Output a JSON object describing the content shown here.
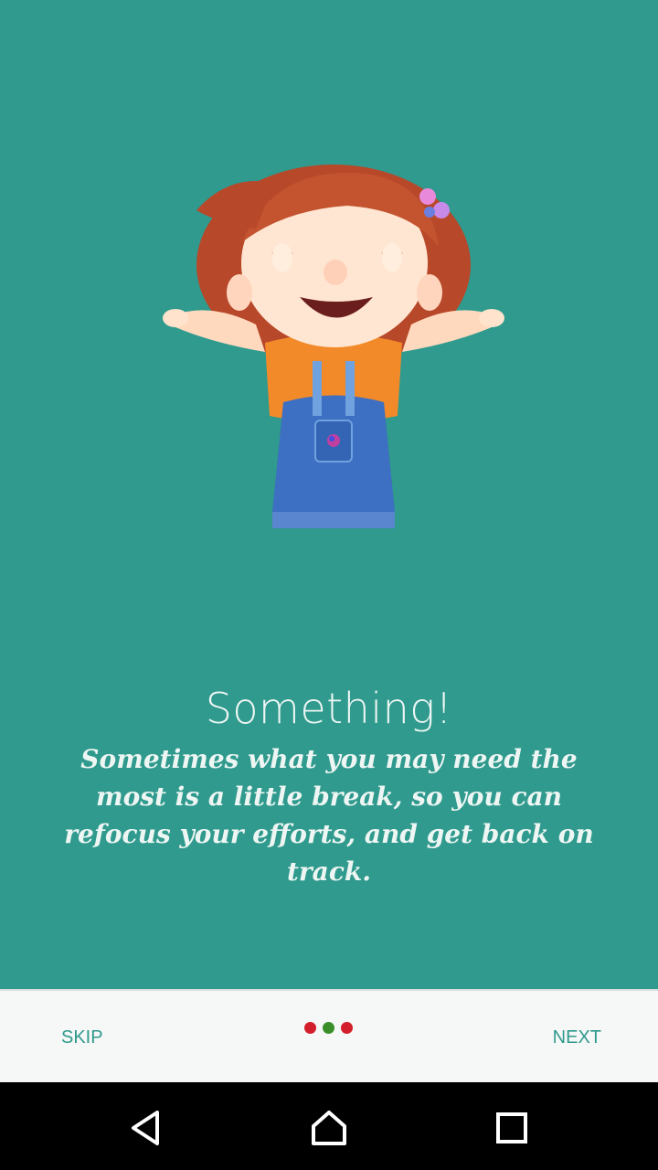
{
  "onboarding": {
    "title": "Something!",
    "body": "Sometimes what you may need the most is a little break, so you can refocus your efforts, and get back on track.",
    "illustration": "cartoon-girl-arms-open"
  },
  "bottom_bar": {
    "skip_label": "SKIP",
    "next_label": "NEXT",
    "page_indicator": {
      "count": 3,
      "active_index": 1,
      "colors": [
        "#d21f2b",
        "#3a8f2a",
        "#d21f2b"
      ]
    }
  },
  "system_nav": {
    "back_icon": "back-triangle-icon",
    "home_icon": "home-icon",
    "recents_icon": "recents-square-icon"
  },
  "colors": {
    "background": "#2f9a8d",
    "text": "#eef6f4",
    "accent": "#2f9a8d",
    "bar": "#f6f7f7"
  }
}
